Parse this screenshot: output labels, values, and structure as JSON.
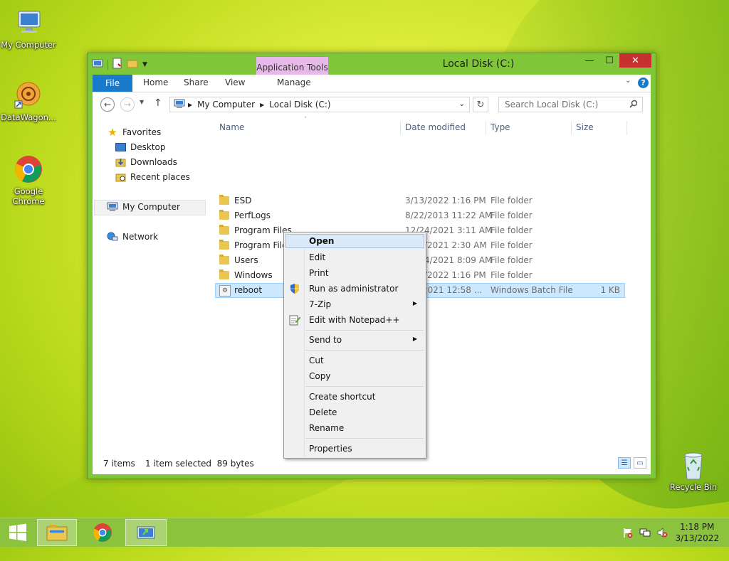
{
  "desktop": {
    "icons": [
      {
        "label": "My Computer"
      },
      {
        "label": "DataWagon..."
      },
      {
        "label": "Google Chrome"
      },
      {
        "label": "Recycle Bin"
      }
    ]
  },
  "window": {
    "title": "Local Disk (C:)",
    "context_tab_group": "Application Tools",
    "ribbon_tabs": [
      "File",
      "Home",
      "Share",
      "View",
      "Manage"
    ],
    "address": {
      "crumbs": [
        "My Computer",
        "Local Disk (C:)"
      ]
    },
    "search_placeholder": "Search Local Disk (C:)",
    "nav": {
      "favorites": "Favorites",
      "desktop": "Desktop",
      "downloads": "Downloads",
      "recent": "Recent places",
      "mycomputer": "My Computer",
      "network": "Network"
    },
    "columns": {
      "name": "Name",
      "date": "Date modified",
      "type": "Type",
      "size": "Size"
    },
    "files": [
      {
        "name": "ESD",
        "date": "3/13/2022 1:16 PM",
        "type": "File folder",
        "size": ""
      },
      {
        "name": "PerfLogs",
        "date": "8/22/2013 11:22 AM",
        "type": "File folder",
        "size": ""
      },
      {
        "name": "Program Files",
        "date": "12/24/2021 3:11 AM",
        "type": "File folder",
        "size": ""
      },
      {
        "name": "Program Files (x86)",
        "date": "8/27/2021 2:30 AM",
        "type": "File folder",
        "size": ""
      },
      {
        "name": "Users",
        "date": "12/24/2021 8:09 AM",
        "type": "File folder",
        "size": ""
      },
      {
        "name": "Windows",
        "date": "3/13/2022 1:16 PM",
        "type": "File folder",
        "size": ""
      },
      {
        "name": "reboot",
        "date": "2021 12:58 ...",
        "type": "Windows Batch File",
        "size": "1 KB"
      }
    ],
    "status": {
      "count": "7 items",
      "selection": "1 item selected  89 bytes"
    }
  },
  "context_menu": {
    "items": [
      {
        "label": "Open"
      },
      {
        "label": "Edit"
      },
      {
        "label": "Print"
      },
      {
        "label": "Run as administrator"
      },
      {
        "label": "7-Zip"
      },
      {
        "label": "Edit with Notepad++"
      },
      {
        "label": "Send to"
      },
      {
        "label": "Cut"
      },
      {
        "label": "Copy"
      },
      {
        "label": "Create shortcut"
      },
      {
        "label": "Delete"
      },
      {
        "label": "Rename"
      },
      {
        "label": "Properties"
      }
    ]
  },
  "taskbar": {
    "time": "1:18 PM",
    "date": "3/13/2022"
  },
  "colors": {
    "accent": "#1979ca",
    "window_frame": "#7fc638",
    "context_tab": "#e8b8ea",
    "selection": "#cce8ff",
    "close_button": "#c7302e"
  }
}
